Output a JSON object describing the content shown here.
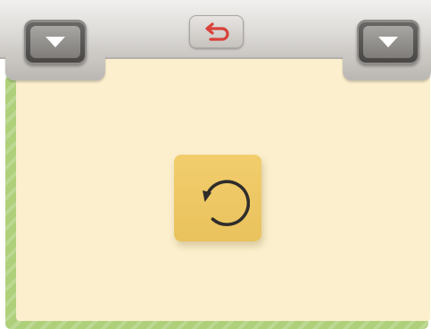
{
  "toolbar": {
    "left_dropdown": {
      "icon": "triangle-down-icon"
    },
    "undo": {
      "icon": "undo-arrow-icon",
      "color": "#d9423a"
    },
    "right_dropdown": {
      "icon": "triangle-down-icon"
    }
  },
  "board": {
    "restart": {
      "icon": "restart-circle-arrow-icon",
      "color": "#ecc560"
    },
    "background_color": "#fbefcd",
    "frame_color": "#aed07a"
  }
}
